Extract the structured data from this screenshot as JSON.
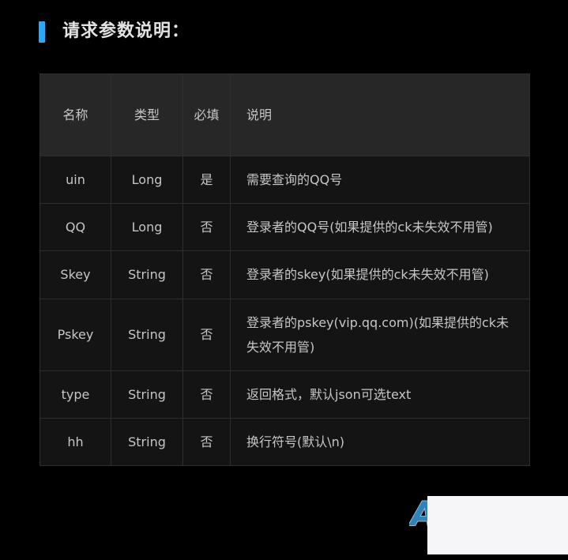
{
  "heading": {
    "text": "请求参数说明：",
    "accent_color": "#29a8ff"
  },
  "table": {
    "columns": [
      "名称",
      "类型",
      "必填",
      "说明"
    ],
    "rows": [
      {
        "name": "uin",
        "type": "Long",
        "required": "是",
        "desc": "需要查询的QQ号"
      },
      {
        "name": "QQ",
        "type": "Long",
        "required": "否",
        "desc": "登录者的QQ号(如果提供的ck未失效不用管)"
      },
      {
        "name": "Skey",
        "type": "String",
        "required": "否",
        "desc": "登录者的skey(如果提供的ck未失效不用管)"
      },
      {
        "name": "Pskey",
        "type": "String",
        "required": "否",
        "desc": "登录者的pskey(vip.qq.com)(如果提供的ck未失效不用管)"
      },
      {
        "name": "type",
        "type": "String",
        "required": "否",
        "desc": "返回格式，默认json可选text"
      },
      {
        "name": "hh",
        "type": "String",
        "required": "否",
        "desc": "换行符号(默认\\n)"
      }
    ]
  },
  "watermark": {
    "letter": "A",
    "color": "#2f83b8"
  },
  "theme": {
    "page_background": "#000000",
    "header_cell_background": "#272727",
    "body_cell_background": "#141414",
    "border_color": "#2e2e2e",
    "text_color": "#c6c6c6",
    "heading_text_color": "#e3e3e3",
    "overlay_color": "#f6f6f8"
  }
}
